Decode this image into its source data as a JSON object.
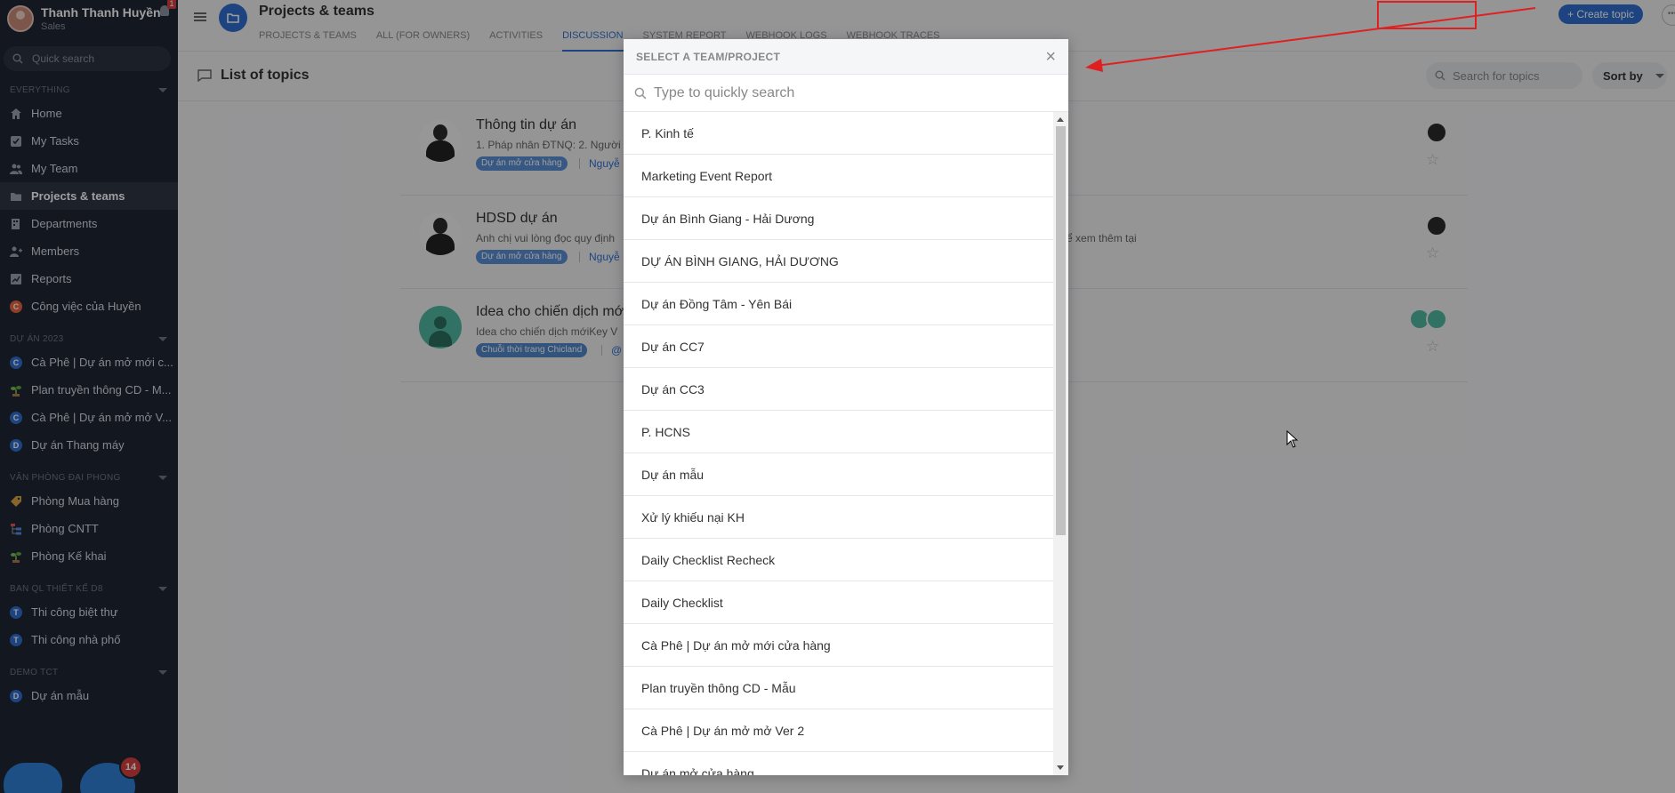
{
  "user": {
    "name": "Thanh Thanh Huyền",
    "role": "Sales",
    "notification_count": "1"
  },
  "sidebar": {
    "search_placeholder": "Quick search",
    "sections": [
      {
        "title": "EVERYTHING",
        "items": [
          {
            "label": "Home",
            "icon": "home-icon"
          },
          {
            "label": "My Tasks",
            "icon": "check-icon"
          },
          {
            "label": "My Team",
            "icon": "team-icon"
          },
          {
            "label": "Projects & teams",
            "icon": "folder-icon",
            "active": true
          },
          {
            "label": "Departments",
            "icon": "departments-icon"
          },
          {
            "label": "Members",
            "icon": "members-icon"
          },
          {
            "label": "Reports",
            "icon": "chart-icon"
          },
          {
            "label": "Công việc của Huyền",
            "icon": "letter-c",
            "badge_letter": "C",
            "color": "#e8643c"
          }
        ]
      },
      {
        "title": "DỰ ÁN 2023",
        "items": [
          {
            "label": "Cà Phê | Dự án mở mới c...",
            "badge_letter": "C",
            "color": "#2f6fd0"
          },
          {
            "label": "Plan truyền thông CD - M...",
            "icon": "plant-icon"
          },
          {
            "label": "Cà Phê | Dự án mở mở V...",
            "badge_letter": "C",
            "color": "#2f6fd0"
          },
          {
            "label": "Dự án Thang máy",
            "badge_letter": "D",
            "color": "#2f6fd0"
          }
        ]
      },
      {
        "title": "VĂN PHÒNG ĐẠI PHONG",
        "items": [
          {
            "label": "Phòng Mua hàng",
            "icon": "tag-icon"
          },
          {
            "label": "Phòng CNTT",
            "icon": "hierarchy-icon"
          },
          {
            "label": "Phòng Kế khai",
            "icon": "plant-icon"
          }
        ]
      },
      {
        "title": "BAN QL THIẾT KẾ D8",
        "items": [
          {
            "label": "Thi công biệt thự",
            "badge_letter": "T",
            "color": "#2f6fd0"
          },
          {
            "label": "Thi công nhà phố",
            "badge_letter": "T",
            "color": "#2f6fd0"
          }
        ]
      },
      {
        "title": "DEMO TCT",
        "items": [
          {
            "label": "Dự án mẫu",
            "badge_letter": "D",
            "color": "#2f6fd0"
          }
        ]
      }
    ],
    "fab_badge": "14"
  },
  "header": {
    "title": "Projects & teams",
    "tabs": [
      "PROJECTS & TEAMS",
      "ALL (FOR OWNERS)",
      "ACTIVITIES",
      "DISCUSSION",
      "SYSTEM REPORT",
      "WEBHOOK LOGS",
      "WEBHOOK TRACES"
    ],
    "active_tab": 3,
    "create_label": "+ Create topic"
  },
  "toolbar": {
    "list_title": "List of topics",
    "search_placeholder": "Search for topics",
    "sort_label": "Sort by"
  },
  "topics": [
    {
      "title": "Thông tin dự án",
      "desc": "1. Pháp nhân ĐTNQ: 2. Người",
      "tag": "Dự án mở cửa hàng",
      "link": "Nguyễ",
      "avatar": "person",
      "members": [
        "dark"
      ]
    },
    {
      "title": "HDSD dự án",
      "desc": "Anh chị vui lòng đọc quy định",
      "desc_right": "thể xem thêm tại",
      "tag": "Dự án mở cửa hàng",
      "link": "Nguyễ",
      "avatar": "person",
      "members": [
        "dark"
      ]
    },
    {
      "title": "Idea cho chiến dịch mới",
      "desc": "Idea cho chiến dịch mớiKey V",
      "tag": "Chuỗi thời trang Chicland",
      "link": "@",
      "avatar": "generic",
      "members": [
        "green",
        "green"
      ]
    }
  ],
  "modal": {
    "title": "SELECT A TEAM/PROJECT",
    "search_placeholder": "Type to quickly search",
    "items": [
      "P. Kinh tế",
      "Marketing Event Report",
      "Dự án Bình Giang - Hải Dương",
      "DỰ ÁN BÌNH GIANG, HẢI DƯƠNG",
      "Dự án Đồng Tâm - Yên Bái",
      "Dự án CC7",
      "Dự án CC3",
      "P. HCNS",
      "Dự án mẫu",
      "Xử lý khiếu nại KH",
      "Daily Checklist Recheck",
      "Daily Checklist",
      "Cà Phê | Dự án mở mới cửa hàng",
      "Plan truyền thông CD - Mẫu",
      "Cà Phê | Dự án mở mở Ver 2",
      "Dự án mở cửa hàng"
    ]
  }
}
